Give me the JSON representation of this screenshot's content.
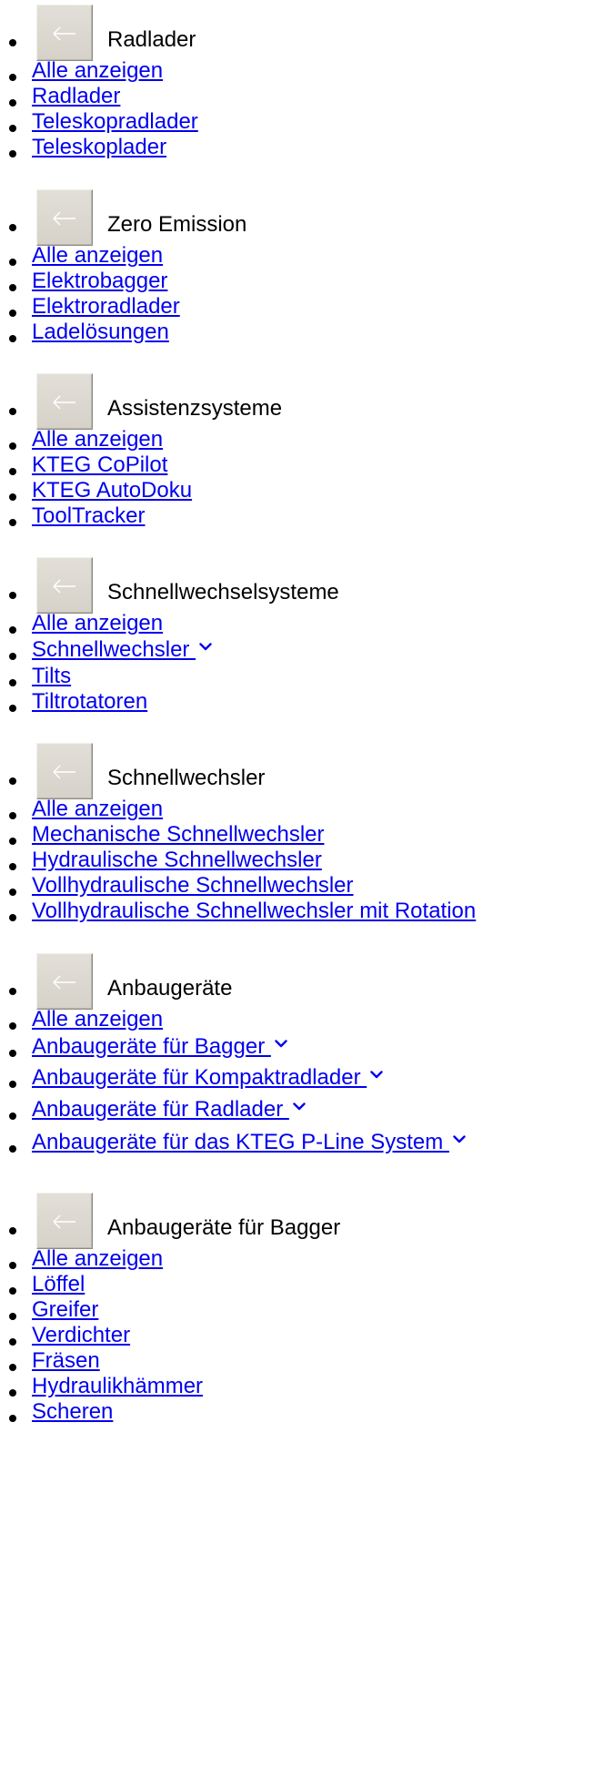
{
  "sections": [
    {
      "title": "Radlader",
      "back_icon": "arrow-left-icon",
      "items": [
        {
          "label": "Alle anzeigen",
          "has_submenu": false
        },
        {
          "label": "Radlader",
          "has_submenu": false
        },
        {
          "label": "Teleskopradlader",
          "has_submenu": false
        },
        {
          "label": "Teleskoplader",
          "has_submenu": false
        }
      ]
    },
    {
      "title": "Zero Emission",
      "back_icon": "arrow-left-icon",
      "items": [
        {
          "label": "Alle anzeigen",
          "has_submenu": false
        },
        {
          "label": "Elektrobagger",
          "has_submenu": false
        },
        {
          "label": "Elektroradlader",
          "has_submenu": false
        },
        {
          "label": "Ladelösungen",
          "has_submenu": false
        }
      ]
    },
    {
      "title": "Assistenzsysteme",
      "back_icon": "arrow-left-icon",
      "items": [
        {
          "label": "Alle anzeigen",
          "has_submenu": false
        },
        {
          "label": "KTEG CoPilot",
          "has_submenu": false
        },
        {
          "label": "KTEG AutoDoku",
          "has_submenu": false
        },
        {
          "label": "ToolTracker",
          "has_submenu": false
        }
      ]
    },
    {
      "title": "Schnellwechselsysteme",
      "back_icon": "arrow-left-icon",
      "items": [
        {
          "label": "Alle anzeigen",
          "has_submenu": false
        },
        {
          "label": "Schnellwechsler ",
          "has_submenu": true
        },
        {
          "label": "Tilts",
          "has_submenu": false
        },
        {
          "label": "Tiltrotatoren",
          "has_submenu": false
        }
      ]
    },
    {
      "title": "Schnellwechsler",
      "back_icon": "arrow-left-icon",
      "items": [
        {
          "label": "Alle anzeigen",
          "has_submenu": false
        },
        {
          "label": "Mechanische Schnellwechsler",
          "has_submenu": false
        },
        {
          "label": "Hydraulische Schnellwechsler",
          "has_submenu": false
        },
        {
          "label": "Vollhydraulische Schnellwechsler",
          "has_submenu": false
        },
        {
          "label": "Vollhydraulische Schnellwechsler mit Rotation",
          "has_submenu": false
        }
      ]
    },
    {
      "title": "Anbaugeräte",
      "back_icon": "arrow-left-icon",
      "items": [
        {
          "label": "Alle anzeigen",
          "has_submenu": false
        },
        {
          "label": "Anbaugeräte für Bagger ",
          "has_submenu": true
        },
        {
          "label": "Anbaugeräte für Kompaktradlader ",
          "has_submenu": true
        },
        {
          "label": "Anbaugeräte für Radlader ",
          "has_submenu": true
        },
        {
          "label": "Anbaugeräte für das KTEG P-Line System ",
          "has_submenu": true
        }
      ]
    },
    {
      "title": "Anbaugeräte für Bagger",
      "back_icon": "arrow-left-icon",
      "items": [
        {
          "label": "Alle anzeigen",
          "has_submenu": false
        },
        {
          "label": "Löffel",
          "has_submenu": false
        },
        {
          "label": "Greifer",
          "has_submenu": false
        },
        {
          "label": "Verdichter",
          "has_submenu": false
        },
        {
          "label": "Fräsen",
          "has_submenu": false
        },
        {
          "label": "Hydraulikhämmer",
          "has_submenu": false
        },
        {
          "label": "Scheren",
          "has_submenu": false
        }
      ]
    }
  ],
  "colors": {
    "link": "#0000ee",
    "text": "#000000",
    "button_face": "#d9d6ce",
    "background": "#ffffff"
  }
}
